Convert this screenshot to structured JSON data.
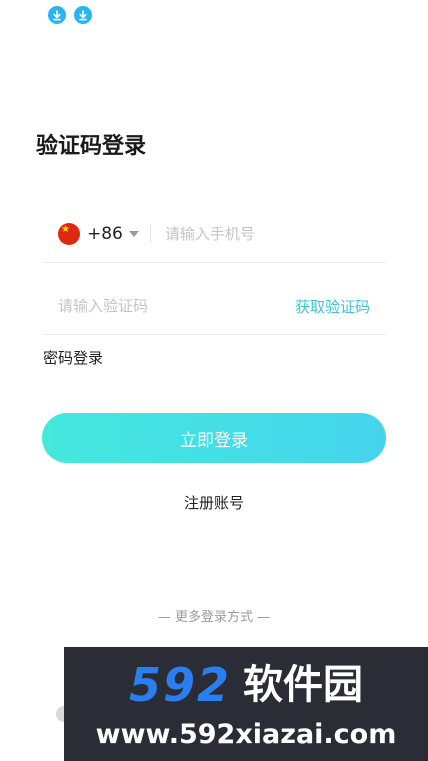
{
  "status_bar": {
    "icons": [
      "download-icon",
      "download-icon"
    ],
    "icon_color": "#2bb5f0"
  },
  "title": "验证码登录",
  "phone": {
    "country_flag": "china-flag-icon",
    "country_code": "+86",
    "placeholder": "请输入手机号"
  },
  "code": {
    "placeholder": "请输入验证码",
    "get_code_label": "获取验证码"
  },
  "password_login_label": "密码登录",
  "login_button_label": "立即登录",
  "register_label": "注册账号",
  "more_login_label": "— 更多登录方式 —",
  "watermark": {
    "number": "592",
    "brand": "软件园",
    "url": "www.592xiazai.com"
  },
  "colors": {
    "accent": "#3cc6d8",
    "button_gradient_start": "#44e8dc",
    "button_gradient_end": "#45d4ee"
  }
}
